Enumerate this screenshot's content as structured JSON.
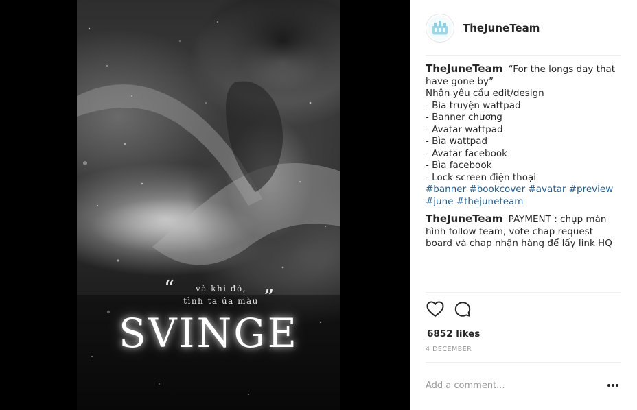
{
  "post": {
    "image": {
      "tagline_line1": "và khi đó,",
      "tagline_line2": "tình ta úa màu",
      "quote_open": "“",
      "quote_close": "”",
      "title": "SVINGE"
    },
    "author": {
      "username": "TheJuneTeam",
      "avatar_icon": "thejuneteam-logo-icon"
    },
    "caption": {
      "username": "TheJuneTeam",
      "quote": "“For the longs day that have gone by”",
      "lines": [
        "Nhận yêu cầu edit/design",
        "- Bìa truyện wattpad",
        "- Banner chương",
        "- Avatar wattpad",
        "- Bìa wattpad",
        "- Avatar facebook",
        "- Bìa facebook",
        "- Lock screen điện thoại"
      ],
      "hashtags": [
        "#banner",
        "#bookcover",
        "#avatar",
        "#preview",
        "#june",
        "#thejuneteam"
      ]
    },
    "comment": {
      "username": "TheJuneTeam",
      "text": "PAYMENT : chụp màn hình follow team, vote chap request board và chap nhận hàng để lấy link HQ"
    },
    "actions": {
      "like_icon": "heart-icon",
      "comment_icon": "comment-bubble-icon"
    },
    "likes": "6852 likes",
    "date": "4 DECEMBER",
    "add_comment_placeholder": "Add a comment...",
    "more_icon": "more-options-icon",
    "colors": {
      "link": "#1b5f9e",
      "text": "#262626",
      "muted": "#999999",
      "divider": "#efefef"
    }
  }
}
